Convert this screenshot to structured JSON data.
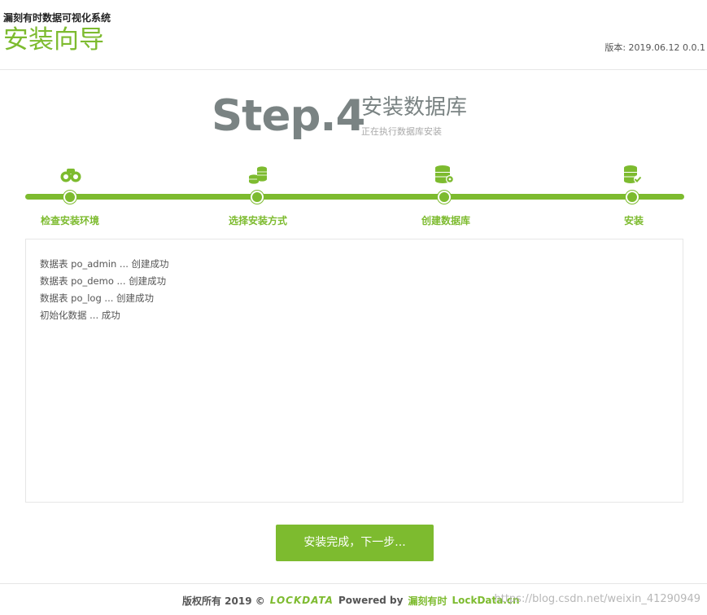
{
  "header": {
    "app_title": "漏刻有时数据可视化系统",
    "wizard_title": "安装向导",
    "version": "版本: 2019.06.12 0.0.1"
  },
  "step": {
    "number": "Step.4",
    "title": "安装数据库",
    "subtitle": "正在执行数据库安装"
  },
  "stages": [
    {
      "label": "检查安装环境",
      "icon": "binoculars-icon"
    },
    {
      "label": "选择安装方式",
      "icon": "coins-stack-icon"
    },
    {
      "label": "创建数据库",
      "icon": "database-settings-icon"
    },
    {
      "label": "安装",
      "icon": "database-check-icon"
    }
  ],
  "log": [
    "数据表 po_admin ... 创建成功",
    "数据表 po_demo ... 创建成功",
    "数据表 po_log ... 创建成功",
    "初始化数据 ... 成功"
  ],
  "button": {
    "next_label": "安装完成，下一步..."
  },
  "footer": {
    "copyright": "版权所有 2019 ©",
    "logo_text": "LOCKDATA",
    "powered_by": "Powered by",
    "brand_name": "漏刻有时",
    "brand_site": "LockData.cn",
    "watermark": "https://blog.csdn.net/weixin_41290949"
  },
  "colors": {
    "accent": "#7dbb2f",
    "step_gray": "#7a8383"
  }
}
